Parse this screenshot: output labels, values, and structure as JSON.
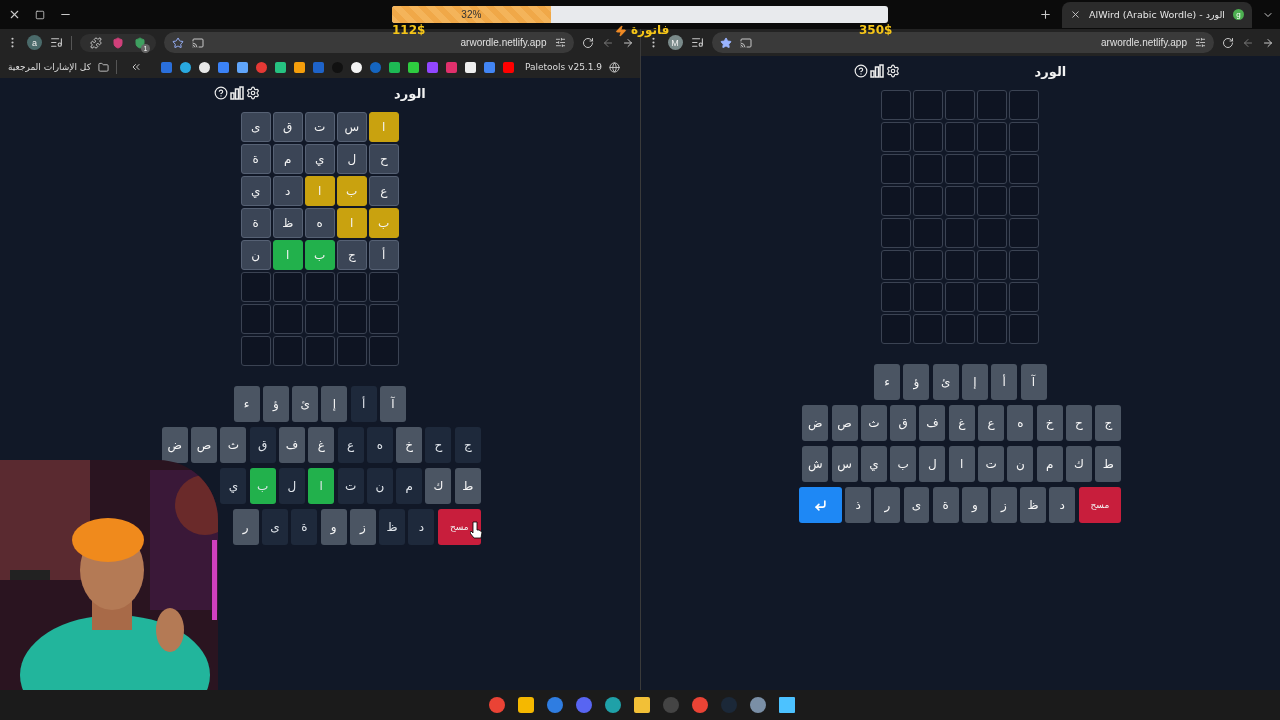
{
  "overlay": {
    "progress": {
      "label": "32%",
      "level": 0.32
    },
    "left_amount": "112$",
    "bill_label": "فاتورة",
    "right_amount": "350$"
  },
  "tab": {
    "title": "AlWird (Arabic Wordle) - الورد",
    "favicon_letter": "g"
  },
  "panes": [
    {
      "url": "arwordle.netlify.app",
      "avatar": "M",
      "game": {
        "title": "الورد",
        "grid": [
          [
            {
              "kind": "empty"
            },
            {
              "kind": "empty"
            },
            {
              "kind": "empty"
            },
            {
              "kind": "empty"
            },
            {
              "kind": "empty"
            }
          ],
          [
            {
              "kind": "empty"
            },
            {
              "kind": "empty"
            },
            {
              "kind": "empty"
            },
            {
              "kind": "empty"
            },
            {
              "kind": "empty"
            }
          ],
          [
            {
              "kind": "empty"
            },
            {
              "kind": "empty"
            },
            {
              "kind": "empty"
            },
            {
              "kind": "empty"
            },
            {
              "kind": "empty"
            }
          ],
          [
            {
              "kind": "empty"
            },
            {
              "kind": "empty"
            },
            {
              "kind": "empty"
            },
            {
              "kind": "empty"
            },
            {
              "kind": "empty"
            }
          ],
          [
            {
              "kind": "empty"
            },
            {
              "kind": "empty"
            },
            {
              "kind": "empty"
            },
            {
              "kind": "empty"
            },
            {
              "kind": "empty"
            }
          ],
          [
            {
              "kind": "empty"
            },
            {
              "kind": "empty"
            },
            {
              "kind": "empty"
            },
            {
              "kind": "empty"
            },
            {
              "kind": "empty"
            }
          ],
          [
            {
              "kind": "empty"
            },
            {
              "kind": "empty"
            },
            {
              "kind": "empty"
            },
            {
              "kind": "empty"
            },
            {
              "kind": "empty"
            }
          ],
          [
            {
              "kind": "empty"
            },
            {
              "kind": "empty"
            },
            {
              "kind": "empty"
            },
            {
              "kind": "empty"
            },
            {
              "kind": "empty"
            }
          ]
        ],
        "keyboard": [
          [
            {
              "kind": "letter",
              "label": "آ",
              "used": false,
              "correct": false
            },
            {
              "kind": "letter",
              "label": "أ",
              "used": false,
              "correct": false
            },
            {
              "kind": "letter",
              "label": "إ",
              "used": false,
              "correct": false
            },
            {
              "kind": "letter",
              "label": "ئ",
              "used": false,
              "correct": false
            },
            {
              "kind": "letter",
              "label": "ؤ",
              "used": false,
              "correct": false
            },
            {
              "kind": "letter",
              "label": "ء",
              "used": false,
              "correct": false
            }
          ],
          [
            {
              "kind": "letter",
              "label": "ج",
              "used": false,
              "correct": false
            },
            {
              "kind": "letter",
              "label": "ح",
              "used": false,
              "correct": false
            },
            {
              "kind": "letter",
              "label": "خ",
              "used": false,
              "correct": false
            },
            {
              "kind": "letter",
              "label": "ه",
              "used": false,
              "correct": false
            },
            {
              "kind": "letter",
              "label": "ع",
              "used": false,
              "correct": false
            },
            {
              "kind": "letter",
              "label": "غ",
              "used": false,
              "correct": false
            },
            {
              "kind": "letter",
              "label": "ف",
              "used": false,
              "correct": false
            },
            {
              "kind": "letter",
              "label": "ق",
              "used": false,
              "correct": false
            },
            {
              "kind": "letter",
              "label": "ث",
              "used": false,
              "correct": false
            },
            {
              "kind": "letter",
              "label": "ص",
              "used": false,
              "correct": false
            },
            {
              "kind": "letter",
              "label": "ض",
              "used": false,
              "correct": false
            }
          ],
          [
            {
              "kind": "letter",
              "label": "ط",
              "used": false,
              "correct": false
            },
            {
              "kind": "letter",
              "label": "ك",
              "used": false,
              "correct": false
            },
            {
              "kind": "letter",
              "label": "م",
              "used": false,
              "correct": false
            },
            {
              "kind": "letter",
              "label": "ن",
              "used": false,
              "correct": false
            },
            {
              "kind": "letter",
              "label": "ت",
              "used": false,
              "correct": false
            },
            {
              "kind": "letter",
              "label": "ا",
              "used": false,
              "correct": false
            },
            {
              "kind": "letter",
              "label": "ل",
              "used": false,
              "correct": false
            },
            {
              "kind": "letter",
              "label": "ب",
              "used": false,
              "correct": false
            },
            {
              "kind": "letter",
              "label": "ي",
              "used": false,
              "correct": false
            },
            {
              "kind": "letter",
              "label": "س",
              "used": false,
              "correct": false
            },
            {
              "kind": "letter",
              "label": "ش",
              "used": false,
              "correct": false
            }
          ],
          [
            {
              "kind": "delete",
              "label": "مسح"
            },
            {
              "kind": "letter",
              "label": "د",
              "used": false,
              "correct": false
            },
            {
              "kind": "letter",
              "label": "ظ",
              "used": false,
              "correct": false
            },
            {
              "kind": "letter",
              "label": "ز",
              "used": false,
              "correct": false
            },
            {
              "kind": "letter",
              "label": "و",
              "used": false,
              "correct": false
            },
            {
              "kind": "letter",
              "label": "ة",
              "used": false,
              "correct": false
            },
            {
              "kind": "letter",
              "label": "ى",
              "used": false,
              "correct": false
            },
            {
              "kind": "letter",
              "label": "ر",
              "used": false,
              "correct": false
            },
            {
              "kind": "letter",
              "label": "ذ",
              "used": false,
              "correct": false
            },
            {
              "kind": "enter"
            }
          ]
        ]
      }
    },
    {
      "url": "arwordle.netlify.app",
      "avatar": "a",
      "extension_badge": "1",
      "bookmarks_bar": {
        "all_label": "كل الإشارات المرجعية",
        "extension_label": "Paletools v25.1.9"
      },
      "game": {
        "title": "الورد",
        "grid": [
          [
            {
              "letter": "ا",
              "kind": "present"
            },
            {
              "letter": "س",
              "kind": "absent"
            },
            {
              "letter": "ت",
              "kind": "absent"
            },
            {
              "letter": "ق",
              "kind": "absent"
            },
            {
              "letter": "ى",
              "kind": "absent"
            }
          ],
          [
            {
              "letter": "ح",
              "kind": "absent"
            },
            {
              "letter": "ل",
              "kind": "absent"
            },
            {
              "letter": "ي",
              "kind": "absent"
            },
            {
              "letter": "م",
              "kind": "absent"
            },
            {
              "letter": "ة",
              "kind": "absent"
            }
          ],
          [
            {
              "letter": "ع",
              "kind": "absent"
            },
            {
              "letter": "ب",
              "kind": "present"
            },
            {
              "letter": "ا",
              "kind": "present"
            },
            {
              "letter": "د",
              "kind": "absent"
            },
            {
              "letter": "ي",
              "kind": "absent"
            }
          ],
          [
            {
              "letter": "ب",
              "kind": "present"
            },
            {
              "letter": "ا",
              "kind": "present"
            },
            {
              "letter": "ه",
              "kind": "absent"
            },
            {
              "letter": "ظ",
              "kind": "absent"
            },
            {
              "letter": "ة",
              "kind": "absent"
            }
          ],
          [
            {
              "letter": "أ",
              "kind": "absent"
            },
            {
              "letter": "ج",
              "kind": "absent"
            },
            {
              "letter": "ب",
              "kind": "correct"
            },
            {
              "letter": "ا",
              "kind": "correct"
            },
            {
              "letter": "ن",
              "kind": "absent"
            }
          ],
          [
            {
              "kind": "empty"
            },
            {
              "kind": "empty"
            },
            {
              "kind": "empty"
            },
            {
              "kind": "empty"
            },
            {
              "kind": "empty"
            }
          ],
          [
            {
              "kind": "empty"
            },
            {
              "kind": "empty"
            },
            {
              "kind": "empty"
            },
            {
              "kind": "empty"
            },
            {
              "kind": "empty"
            }
          ],
          [
            {
              "kind": "empty"
            },
            {
              "kind": "empty"
            },
            {
              "kind": "empty"
            },
            {
              "kind": "empty"
            },
            {
              "kind": "empty"
            }
          ]
        ],
        "keyboard": [
          [
            {
              "kind": "letter",
              "label": "آ",
              "used": false,
              "correct": false
            },
            {
              "kind": "letter",
              "label": "أ",
              "used": true,
              "correct": false
            },
            {
              "kind": "letter",
              "label": "إ",
              "used": false,
              "correct": false
            },
            {
              "kind": "letter",
              "label": "ئ",
              "used": false,
              "correct": false
            },
            {
              "kind": "letter",
              "label": "ؤ",
              "used": false,
              "correct": false
            },
            {
              "kind": "letter",
              "label": "ء",
              "used": false,
              "correct": false
            }
          ],
          [
            {
              "kind": "letter",
              "label": "ج",
              "used": true,
              "correct": false
            },
            {
              "kind": "letter",
              "label": "ح",
              "used": true,
              "correct": false
            },
            {
              "kind": "letter",
              "label": "خ",
              "used": false,
              "correct": false
            },
            {
              "kind": "letter",
              "label": "ه",
              "used": true,
              "correct": false
            },
            {
              "kind": "letter",
              "label": "ع",
              "used": true,
              "correct": false
            },
            {
              "kind": "letter",
              "label": "غ",
              "used": false,
              "correct": false
            },
            {
              "kind": "letter",
              "label": "ف",
              "used": false,
              "correct": false
            },
            {
              "kind": "letter",
              "label": "ق",
              "used": true,
              "correct": false
            },
            {
              "kind": "letter",
              "label": "ث",
              "used": false,
              "correct": false
            },
            {
              "kind": "letter",
              "label": "ص",
              "used": false,
              "correct": false
            },
            {
              "kind": "letter",
              "label": "ض",
              "used": false,
              "correct": false
            }
          ],
          [
            {
              "kind": "letter",
              "label": "ط",
              "used": false,
              "correct": false
            },
            {
              "kind": "letter",
              "label": "ك",
              "used": false,
              "correct": false
            },
            {
              "kind": "letter",
              "label": "م",
              "used": true,
              "correct": false
            },
            {
              "kind": "letter",
              "label": "ن",
              "used": true,
              "correct": false
            },
            {
              "kind": "letter",
              "label": "ت",
              "used": true,
              "correct": false
            },
            {
              "kind": "letter",
              "label": "ا",
              "used": true,
              "correct": true
            },
            {
              "kind": "letter",
              "label": "ل",
              "used": true,
              "correct": false
            },
            {
              "kind": "letter",
              "label": "ب",
              "used": true,
              "correct": true
            },
            {
              "kind": "letter",
              "label": "ي",
              "used": true,
              "correct": false
            }
          ],
          [
            {
              "kind": "delete",
              "label": "مسح"
            },
            {
              "kind": "letter",
              "label": "د",
              "used": true,
              "correct": false
            },
            {
              "kind": "letter",
              "label": "ظ",
              "used": true,
              "correct": false
            },
            {
              "kind": "letter",
              "label": "ز",
              "used": false,
              "correct": false
            },
            {
              "kind": "letter",
              "label": "و",
              "used": false,
              "correct": false
            },
            {
              "kind": "letter",
              "label": "ة",
              "used": true,
              "correct": false
            },
            {
              "kind": "letter",
              "label": "ى",
              "used": true,
              "correct": false
            },
            {
              "kind": "letter",
              "label": "ر",
              "used": false,
              "correct": false
            }
          ]
        ]
      }
    }
  ]
}
